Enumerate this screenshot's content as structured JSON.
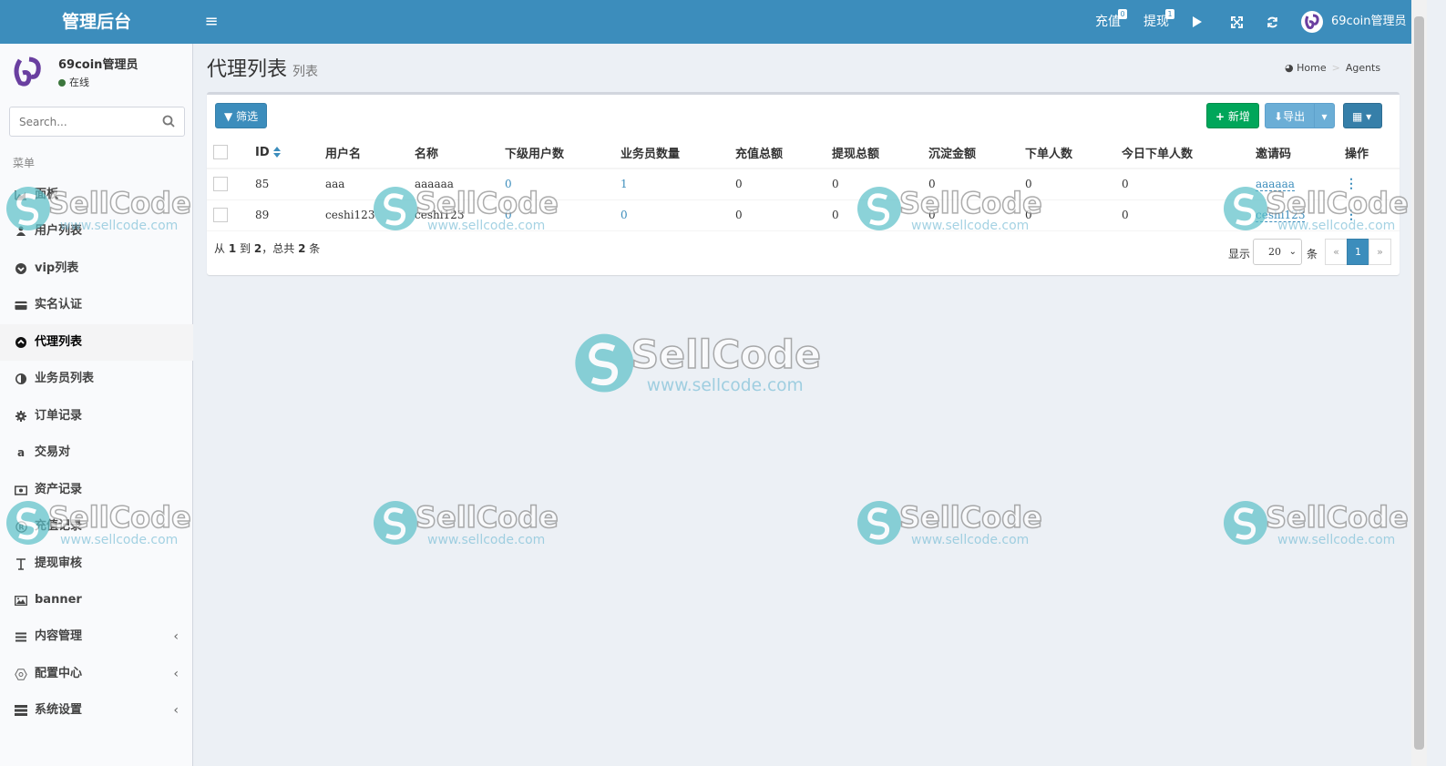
{
  "header": {
    "logo": "管理后台",
    "recharge_label": "充值",
    "recharge_badge": "0",
    "withdraw_label": "提现",
    "withdraw_badge": "1",
    "user_name": "69coin管理员"
  },
  "sidebar": {
    "user_name": "69coin管理员",
    "status": "在线",
    "search_placeholder": "Search...",
    "menu_header": "菜单",
    "items": [
      {
        "label": "面板",
        "icon": "area-chart-icon"
      },
      {
        "label": "用户列表",
        "icon": "users-icon"
      },
      {
        "label": "vip列表",
        "icon": "chevron-circle-icon"
      },
      {
        "label": "实名认证",
        "icon": "credit-card-icon"
      },
      {
        "label": "代理列表",
        "icon": "arrow-circle-icon",
        "active": true
      },
      {
        "label": "业务员列表",
        "icon": "adjust-icon"
      },
      {
        "label": "订单记录",
        "icon": "gear-icon"
      },
      {
        "label": "交易对",
        "icon": "amazon-icon"
      },
      {
        "label": "资产记录",
        "icon": "money-icon"
      },
      {
        "label": "充值记录",
        "icon": "registered-icon"
      },
      {
        "label": "提现审核",
        "icon": "text-height-icon"
      },
      {
        "label": "banner",
        "icon": "image-icon"
      },
      {
        "label": "内容管理",
        "icon": "list-icon",
        "expandable": true
      },
      {
        "label": "配置中心",
        "icon": "hexagon-icon",
        "expandable": true
      },
      {
        "label": "系统设置",
        "icon": "server-icon",
        "expandable": true
      }
    ]
  },
  "page": {
    "title": "代理列表",
    "subtitle": "列表",
    "breadcrumb_home": "Home",
    "breadcrumb_current": "Agents"
  },
  "toolbar": {
    "filter_label": "筛选",
    "add_label": "新增",
    "export_label": "导出"
  },
  "table": {
    "columns": [
      "ID",
      "用户名",
      "名称",
      "下级用户数",
      "业务员数量",
      "充值总额",
      "提现总额",
      "沉淀金额",
      "下单人数",
      "今日下单人数",
      "邀请码",
      "操作"
    ],
    "rows": [
      {
        "id": "85",
        "username": "aaa",
        "name": "aaaaaa",
        "sub_users": "0",
        "salesmen": "1",
        "recharge_total": "0",
        "withdraw_total": "0",
        "deposit": "0",
        "order_people": "0",
        "today_order_people": "0",
        "invite_code": "aaaaaa"
      },
      {
        "id": "89",
        "username": "ceshi123",
        "name": "ceshi123",
        "sub_users": "0",
        "salesmen": "0",
        "recharge_total": "0",
        "withdraw_total": "0",
        "deposit": "0",
        "order_people": "0",
        "today_order_people": "0",
        "invite_code": "ceshi123"
      }
    ]
  },
  "pager": {
    "info_prefix": "从",
    "from": "1",
    "to_label": "到",
    "to": "2",
    "total_prefix": "，总共",
    "total": "2",
    "total_suffix": "条",
    "show_label": "显示",
    "page_size": "20",
    "unit_label": "条",
    "prev": "«",
    "current_page": "1",
    "next": "»"
  },
  "watermark": {
    "brand": "SellCode",
    "url": "www.sellcode.com"
  }
}
